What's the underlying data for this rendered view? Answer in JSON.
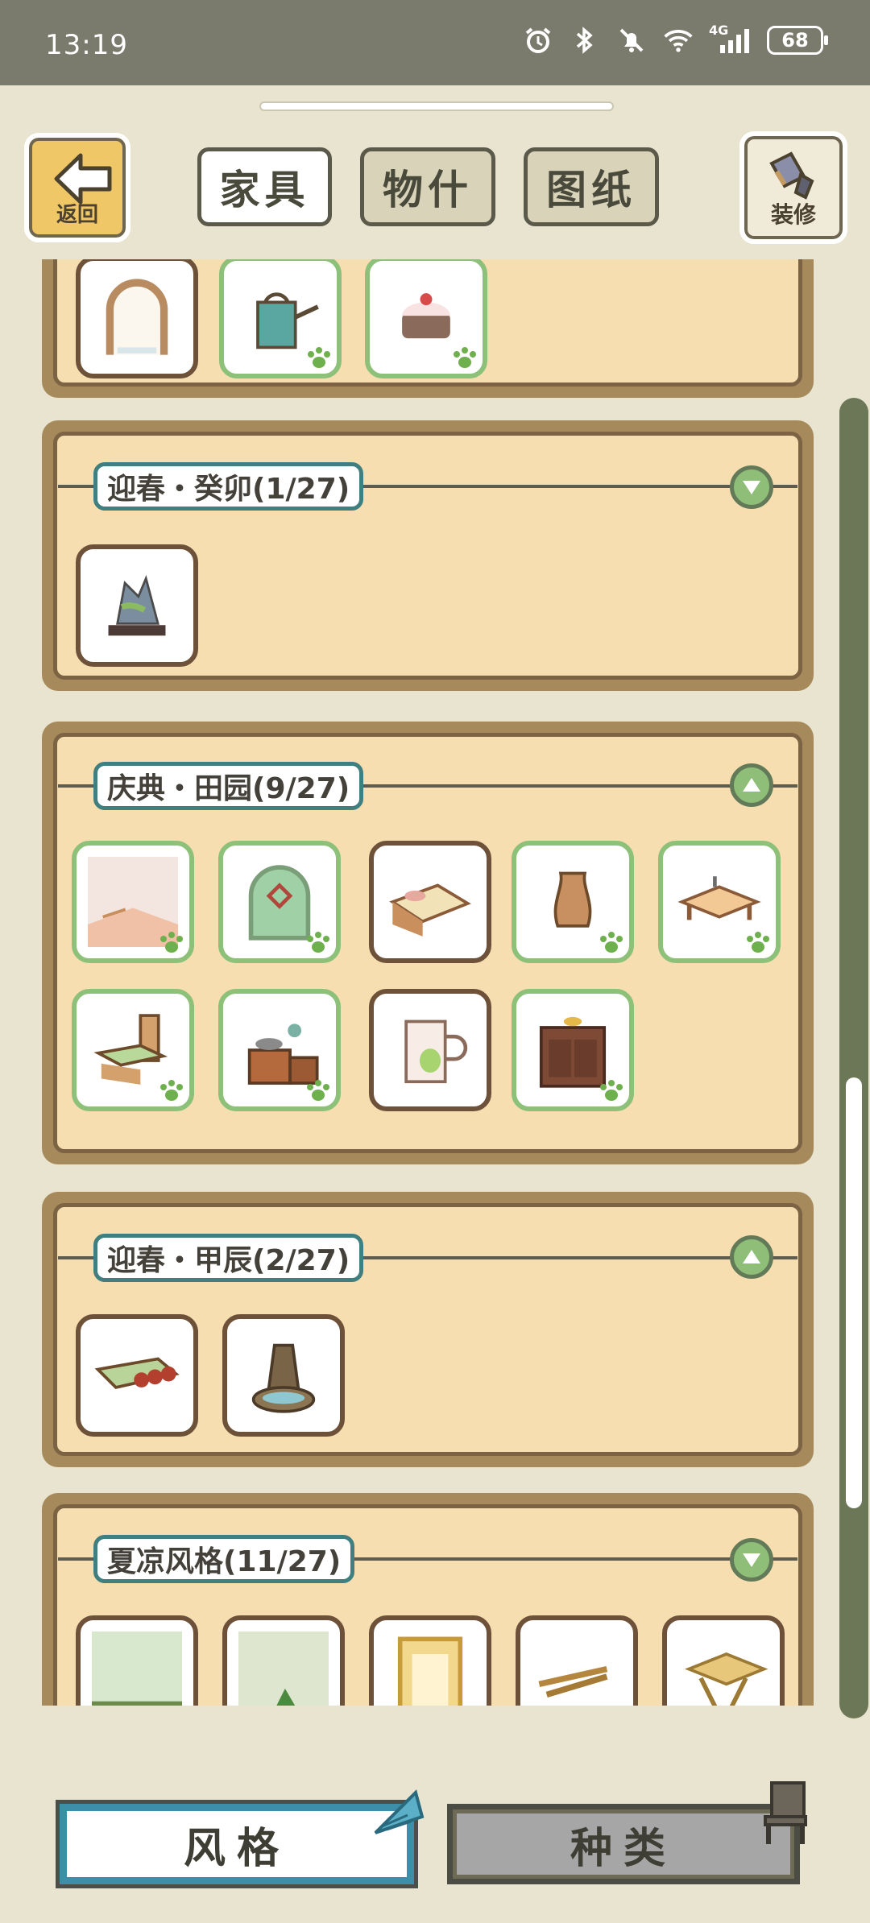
{
  "status_bar": {
    "time": "13:19",
    "icons": [
      "alarm-icon",
      "bluetooth-icon",
      "mute-icon",
      "wifi-icon",
      "signal-4g-icon"
    ],
    "signal_label": "4G",
    "battery": "68"
  },
  "top_bar": {
    "back_label": "返回",
    "decorate_label": "装修",
    "tabs": [
      {
        "label": "家具",
        "active": true
      },
      {
        "label": "物什",
        "active": false
      },
      {
        "label": "图纸",
        "active": false
      }
    ]
  },
  "groups": [
    {
      "title": "",
      "expanded": true,
      "items": [
        {
          "name": "arched-window",
          "owned": true
        },
        {
          "name": "watering-can",
          "owned": false
        },
        {
          "name": "cake",
          "owned": false
        }
      ]
    },
    {
      "title": "迎春・癸卯(1/27)",
      "expanded": false,
      "items": [
        {
          "name": "rock-garden-bonsai",
          "owned": true
        }
      ]
    },
    {
      "title": "庆典・田园(9/27)",
      "expanded": true,
      "items": [
        {
          "name": "picnic-wallpaper",
          "owned": false
        },
        {
          "name": "flower-window",
          "owned": false
        },
        {
          "name": "wooden-bed",
          "owned": true
        },
        {
          "name": "clay-vase",
          "owned": false
        },
        {
          "name": "low-table",
          "owned": false
        },
        {
          "name": "wooden-chair",
          "owned": false
        },
        {
          "name": "stove-set",
          "owned": false
        },
        {
          "name": "mug",
          "owned": true
        },
        {
          "name": "wooden-cabinet",
          "owned": false
        }
      ]
    },
    {
      "title": "迎春・甲辰(2/27)",
      "expanded": true,
      "items": [
        {
          "name": "scroll-rolls",
          "owned": true
        },
        {
          "name": "rock-fountain",
          "owned": true
        }
      ]
    },
    {
      "title": "夏凉风格(11/27)",
      "expanded": false,
      "items": [
        {
          "name": "bamboo-wallpaper",
          "owned": true
        },
        {
          "name": "leaf-floor",
          "owned": true
        },
        {
          "name": "bamboo-door",
          "owned": true
        },
        {
          "name": "bamboo-pile",
          "owned": true
        },
        {
          "name": "bamboo-stool",
          "owned": true
        }
      ]
    }
  ],
  "bottom_tabs": {
    "style_label": "风格",
    "type_label": "种类"
  }
}
